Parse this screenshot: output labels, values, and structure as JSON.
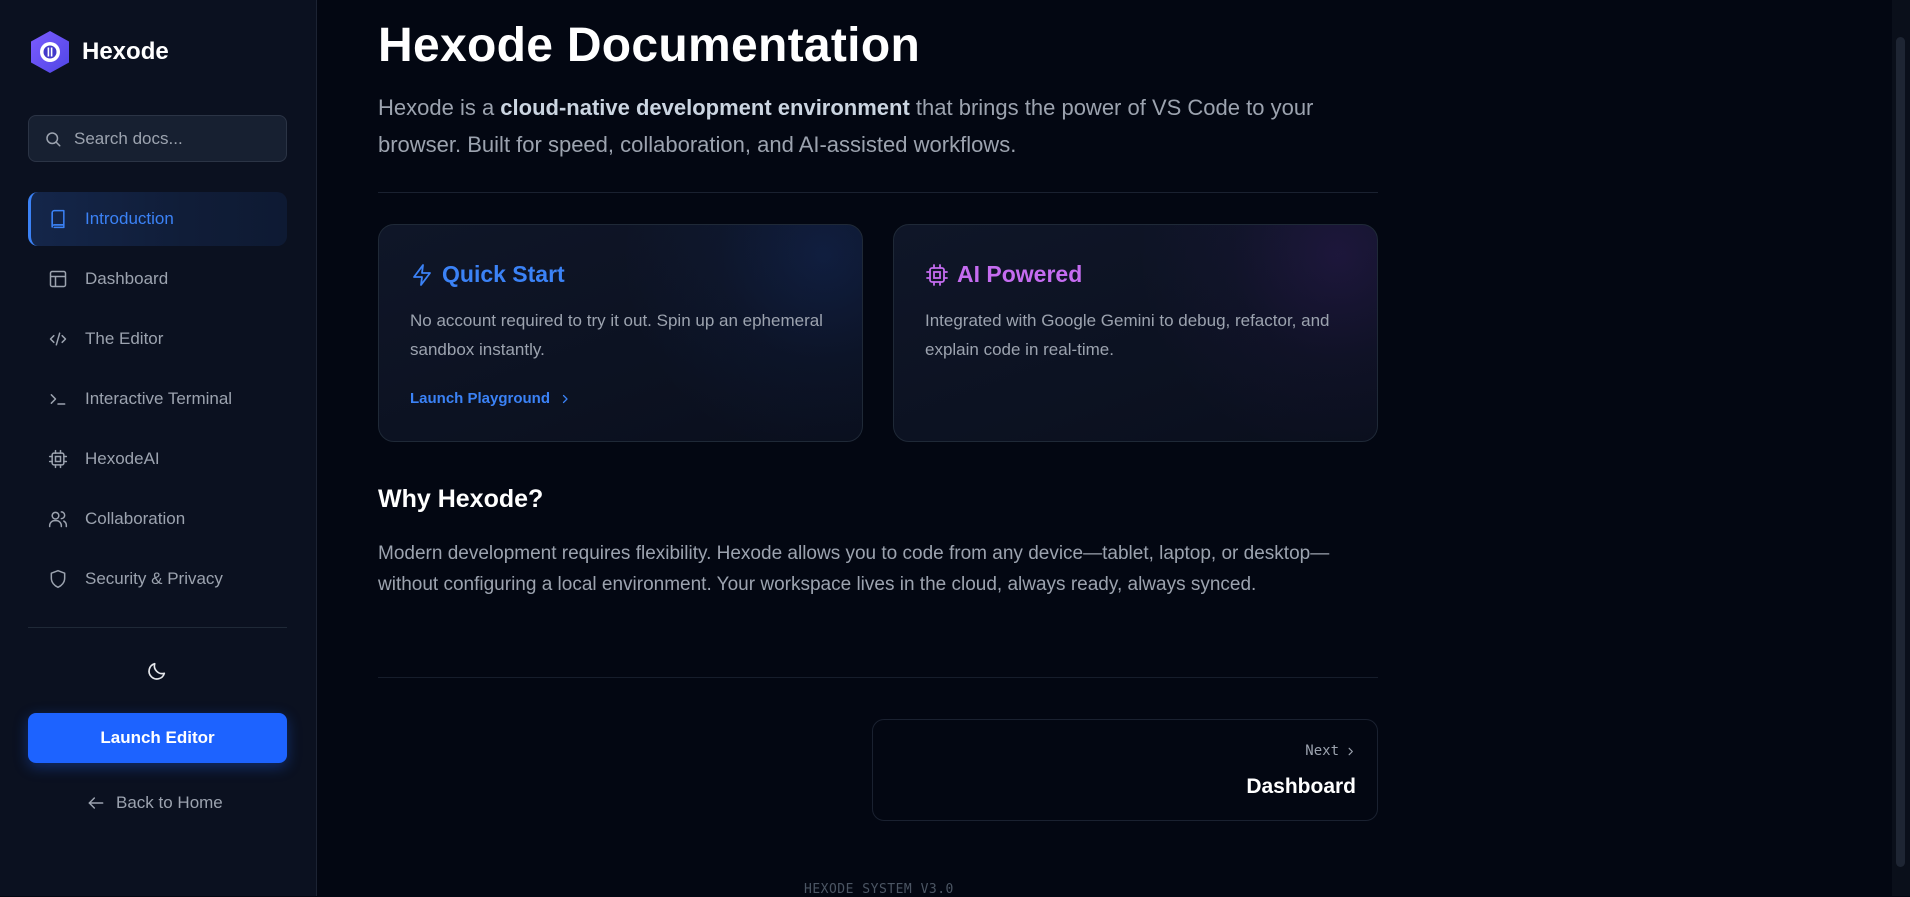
{
  "sidebar": {
    "brand": {
      "name": "Hexode",
      "logo": "hexode-hex-logo"
    },
    "search": {
      "placeholder": "Search docs...",
      "value": "",
      "icon": "search-icon"
    },
    "nav": [
      {
        "label": "Introduction",
        "icon": "book-icon",
        "active": true
      },
      {
        "label": "Dashboard",
        "icon": "layout-icon",
        "active": false
      },
      {
        "label": "The Editor",
        "icon": "code-icon",
        "active": false
      },
      {
        "label": "Interactive Terminal",
        "icon": "terminal-icon",
        "active": false
      },
      {
        "label": "HexodeAI",
        "icon": "cpu-icon",
        "active": false
      },
      {
        "label": "Collaboration",
        "icon": "users-icon",
        "active": false
      },
      {
        "label": "Security & Privacy",
        "icon": "shield-icon",
        "active": false
      }
    ],
    "theme_icon": "moon-icon",
    "launch_label": "Launch Editor",
    "back_label": "Back to Home"
  },
  "main": {
    "title": "Hexode Documentation",
    "intro_pre": "Hexode is a ",
    "intro_bold": "cloud-native development environment",
    "intro_post": " that brings the power of VS Code to your browser. Built for speed, collaboration, and AI-assisted workflows.",
    "cards": [
      {
        "title": "Quick Start",
        "icon": "zap-icon",
        "desc": "No account required to try it out. Spin up an ephemeral sandbox instantly.",
        "link": "Launch Playground"
      },
      {
        "title": "AI Powered",
        "icon": "cpu-icon",
        "desc": "Integrated with Google Gemini to debug, refactor, and explain code in real-time."
      }
    ],
    "why_title": "Why Hexode?",
    "why_text": "Modern development requires flexibility. Hexode allows you to code from any device—tablet, laptop, or desktop—without configuring a local environment. Your workspace lives in the cloud, always ready, always synced.",
    "next": {
      "label": "Next",
      "title": "Dashboard"
    },
    "footer": "HEXODE SYSTEM V3.0"
  },
  "colors": {
    "accent_blue": "#3b82f6",
    "accent_purple": "#c56cf0",
    "button_blue": "#1d63ff",
    "background": "#030712",
    "sidebar_bg": "#0b1120"
  }
}
